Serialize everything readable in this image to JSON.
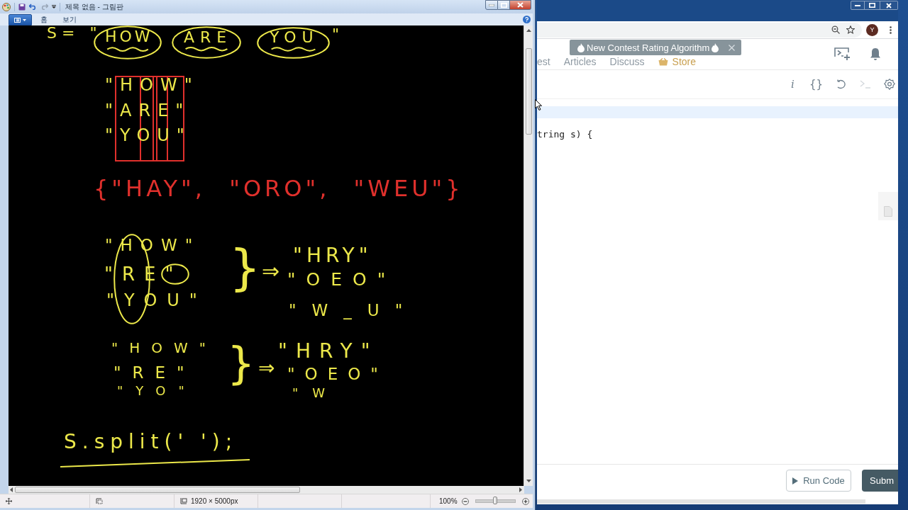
{
  "paint": {
    "title": "제목 없음 - 그림판",
    "tabs": [
      {
        "label": "홈",
        "selected": false
      },
      {
        "label": "보기",
        "selected": false
      }
    ],
    "notes": [
      {
        "kind": "text",
        "text": "S= \"",
        "color": "#ece84a"
      },
      {
        "kind": "text",
        "text": "HOW",
        "color": "#ece84a"
      },
      {
        "kind": "oval",
        "underlined": true,
        "color": "#ece84a"
      },
      {
        "kind": "text",
        "text": "ARE",
        "color": "#ece84a"
      },
      {
        "kind": "oval",
        "underlined": true,
        "color": "#ece84a"
      },
      {
        "kind": "text",
        "text": "YOU",
        "color": "#ece84a"
      },
      {
        "kind": "oval",
        "underlined": true,
        "color": "#ece84a"
      },
      {
        "kind": "text",
        "text": "\"",
        "color": "#ece84a"
      },
      {
        "kind": "box",
        "color": "#e0302c"
      },
      {
        "kind": "box",
        "color": "#e0302c"
      },
      {
        "kind": "box",
        "color": "#e0302c"
      },
      {
        "kind": "text",
        "text": "\"HOW\"",
        "color": "#ece84a"
      },
      {
        "kind": "text",
        "text": "\"ARE\"",
        "color": "#ece84a"
      },
      {
        "kind": "text",
        "text": "\"YOU\"",
        "color": "#ece84a"
      },
      {
        "kind": "text",
        "text": "{\"HAY\", \"ORO\", \"WEU\"}",
        "color": "#e0302c"
      },
      {
        "kind": "oval",
        "underlined": false,
        "color": "#ece84a"
      },
      {
        "kind": "text",
        "text": "\"HOW\"",
        "color": "#ece84a"
      },
      {
        "kind": "text",
        "text": "\"RE\"",
        "color": "#ece84a"
      },
      {
        "kind": "oval",
        "underlined": false,
        "color": "#ece84a"
      },
      {
        "kind": "text",
        "text": "\"YOU\"",
        "color": "#ece84a"
      },
      {
        "kind": "text",
        "text": "}",
        "color": "#ece84a"
      },
      {
        "kind": "text",
        "text": "⇒",
        "color": "#ece84a"
      },
      {
        "kind": "text",
        "text": "\"HRY\"",
        "color": "#ece84a"
      },
      {
        "kind": "text",
        "text": "\"OEO\"",
        "color": "#ece84a"
      },
      {
        "kind": "text",
        "text": "\"W_U\"",
        "color": "#ece84a"
      },
      {
        "kind": "text",
        "text": "\"HOW\"",
        "color": "#ece84a"
      },
      {
        "kind": "text",
        "text": "\"RE\"",
        "color": "#ece84a"
      },
      {
        "kind": "text",
        "text": "\"YO\"",
        "color": "#ece84a"
      },
      {
        "kind": "text",
        "text": "}",
        "color": "#ece84a"
      },
      {
        "kind": "text",
        "text": "⇒",
        "color": "#ece84a"
      },
      {
        "kind": "text",
        "text": "\"HRY\"",
        "color": "#ece84a"
      },
      {
        "kind": "text",
        "text": "\"OEO\"",
        "color": "#ece84a"
      },
      {
        "kind": "text",
        "text": "\"W",
        "color": "#ece84a"
      },
      {
        "kind": "text",
        "text": "S.split(' ');",
        "color": "#ece84a"
      },
      {
        "kind": "underline",
        "color": "#ece84a"
      }
    ],
    "status": {
      "size": "1920 × 5000px",
      "zoom": "100%",
      "slider": {
        "level": 0.5
      }
    }
  },
  "browser": {
    "avatar": "Y",
    "nav": [
      {
        "kind": "link",
        "label": "est"
      },
      {
        "kind": "link",
        "label": "Articles"
      },
      {
        "kind": "link",
        "label": "Discuss"
      },
      {
        "kind": "store",
        "label": "Store"
      }
    ],
    "toast": "New Contest Rating Algorithm",
    "tools": [
      {
        "kind": "info",
        "text": "i",
        "disabled": false
      },
      {
        "kind": "braces",
        "text": "{}",
        "disabled": false
      },
      {
        "kind": "reset",
        "disabled": false
      },
      {
        "kind": "console",
        "disabled": true
      },
      {
        "kind": "settings",
        "disabled": false
      }
    ],
    "code": "tring s) {",
    "buttons": [
      {
        "kind": "run",
        "label": "Run Code"
      },
      {
        "kind": "submit",
        "label": "Subm"
      }
    ]
  }
}
